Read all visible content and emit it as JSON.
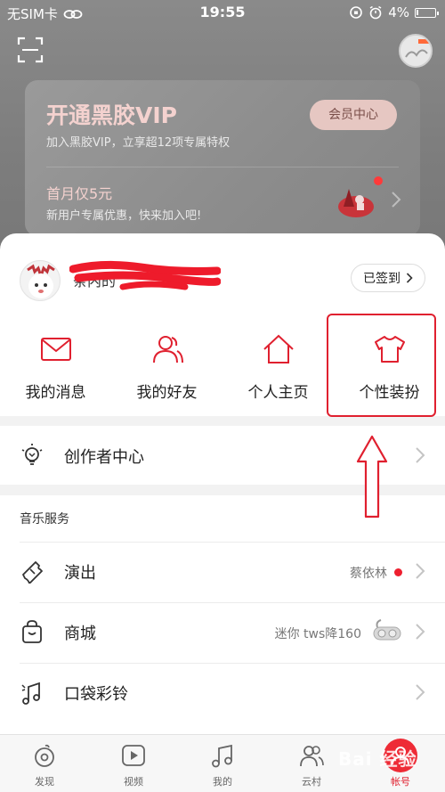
{
  "status_bar": {
    "carrier": "无SIM卡",
    "time": "19:55",
    "battery": "4%"
  },
  "vip_card": {
    "title": "开通黑胶VIP",
    "subtitle": "加入黑胶VIP，立享超12项专属特权",
    "button": "会员中心",
    "promo_title": "首月仅5元",
    "promo_subtitle": "新用户专属优惠，快来加入吧!"
  },
  "profile": {
    "username": "条内的",
    "checkin_label": "已签到"
  },
  "quick_actions": [
    {
      "label": "我的消息",
      "icon": "mail-icon"
    },
    {
      "label": "我的好友",
      "icon": "friends-icon"
    },
    {
      "label": "个人主页",
      "icon": "home-icon"
    },
    {
      "label": "个性装扮",
      "icon": "tshirt-icon"
    }
  ],
  "creator_center": {
    "label": "创作者中心",
    "icon": "lightbulb-icon"
  },
  "music_services": {
    "title": "音乐服务",
    "items": [
      {
        "label": "演出",
        "extra": "蔡依林",
        "icon": "ticket-icon"
      },
      {
        "label": "商城",
        "extra": "迷你 tws降160",
        "icon": "shopping-bag-icon"
      },
      {
        "label": "口袋彩铃",
        "extra": "",
        "icon": "ringtone-icon"
      }
    ]
  },
  "bottom_nav": [
    {
      "label": "发现",
      "icon": "discover-icon",
      "active": false
    },
    {
      "label": "视频",
      "icon": "video-icon",
      "active": false
    },
    {
      "label": "我的",
      "icon": "music-note-icon",
      "active": false
    },
    {
      "label": "云村",
      "icon": "community-icon",
      "active": false
    },
    {
      "label": "帐号",
      "icon": "account-icon",
      "active": true
    }
  ],
  "watermark": "Bai 经验",
  "colors": {
    "accent": "#e0202f",
    "vip_text": "#f4d2cf"
  }
}
